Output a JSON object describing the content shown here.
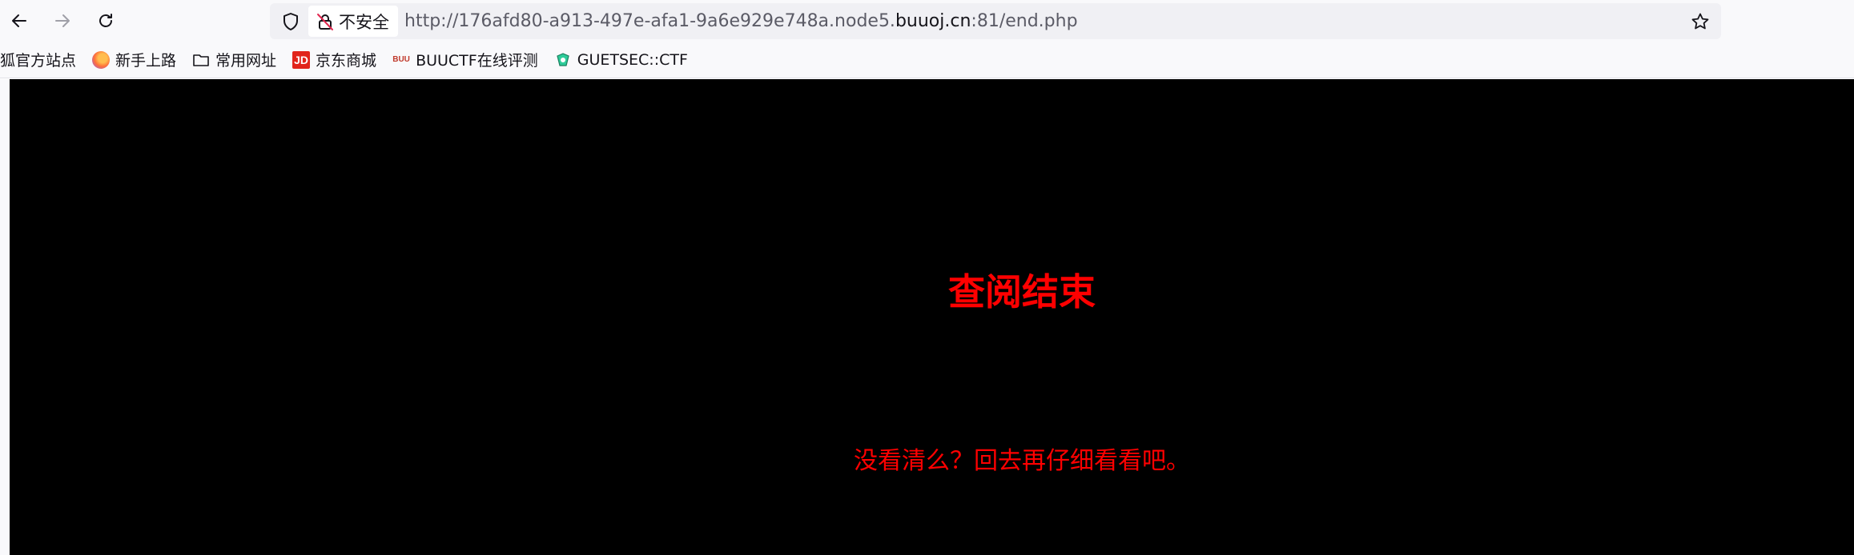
{
  "browser": {
    "security_label": "不安全",
    "url_prefix": "http://176afd80-a913-497e-afa1-9a6e929e748a.node5.",
    "url_host": "buuoj.cn",
    "url_suffix": ":81/end.php",
    "icons": {
      "back": "arrow-left-icon",
      "forward": "arrow-right-icon",
      "reload": "reload-icon",
      "shield": "shield-icon",
      "insecure": "insecure-lock-icon",
      "bookmark_star": "star-icon"
    }
  },
  "bookmarks": [
    {
      "label": "狐官方站点",
      "icon": "none"
    },
    {
      "label": "新手上路",
      "icon": "firefox-icon"
    },
    {
      "label": "常用网址",
      "icon": "folder-icon"
    },
    {
      "label": "京东商城",
      "icon": "jd-icon"
    },
    {
      "label": "BUUCTF在线评测",
      "icon": "buuctf-icon"
    },
    {
      "label": "GUETSEC::CTF",
      "icon": "guetsec-icon"
    }
  ],
  "page": {
    "heading": "查阅结束",
    "message": "没看清么？回去再仔细看看吧。",
    "background": "#000000",
    "text_color": "#ff0000"
  }
}
